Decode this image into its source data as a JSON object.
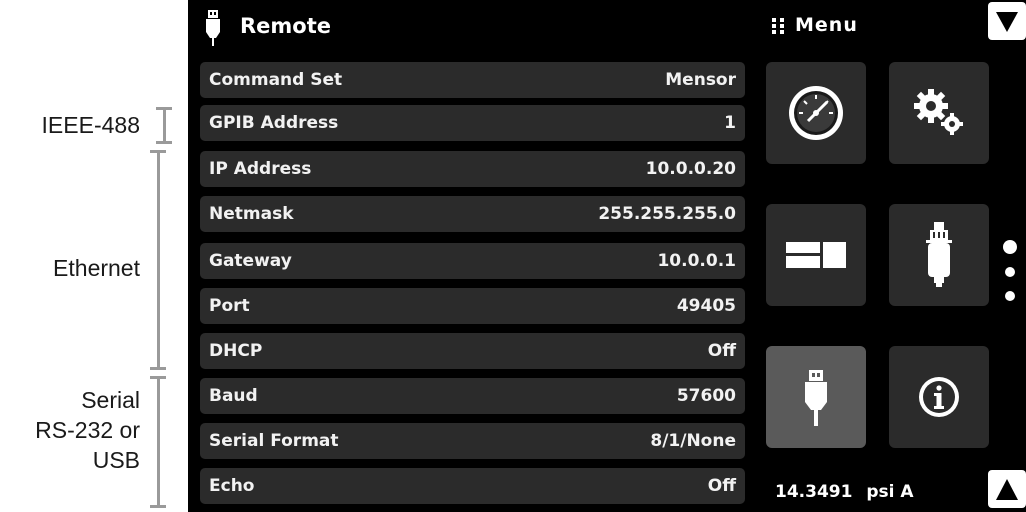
{
  "annotations": {
    "ieee": "IEEE-488",
    "ethernet": "Ethernet",
    "serial_line1": "Serial",
    "serial_line2": "RS-232 or",
    "serial_line3": "USB"
  },
  "header": {
    "title": "Remote",
    "icon": "usb-plug-icon"
  },
  "menu": {
    "title": "Menu",
    "icon": "grid-dots-icon"
  },
  "rows": [
    {
      "label": "Command Set",
      "value": "Mensor"
    },
    {
      "label": "GPIB Address",
      "value": "1"
    },
    {
      "label": "IP Address",
      "value": "10.0.0.20"
    },
    {
      "label": "Netmask",
      "value": "255.255.255.0"
    },
    {
      "label": "Gateway",
      "value": "10.0.0.1"
    },
    {
      "label": "Port",
      "value": "49405"
    },
    {
      "label": "DHCP",
      "value": "Off"
    },
    {
      "label": "Baud",
      "value": "57600"
    },
    {
      "label": "Serial Format",
      "value": "8/1/None"
    },
    {
      "label": "Echo",
      "value": "Off"
    }
  ],
  "tiles": [
    {
      "name": "gauge",
      "icon": "gauge-icon"
    },
    {
      "name": "settings",
      "icon": "gears-icon"
    },
    {
      "name": "display",
      "icon": "display-layout-icon"
    },
    {
      "name": "sensor",
      "icon": "transducer-icon"
    },
    {
      "name": "remote",
      "icon": "usb-plug-icon",
      "active": true
    },
    {
      "name": "info",
      "icon": "info-icon"
    }
  ],
  "status": {
    "reading": "14.3491",
    "unit": "psi A"
  },
  "colors": {
    "background": "#000000",
    "row": "#2b2b2b",
    "active_tile": "#5a5a5a",
    "bracket": "#9a9a9a"
  }
}
